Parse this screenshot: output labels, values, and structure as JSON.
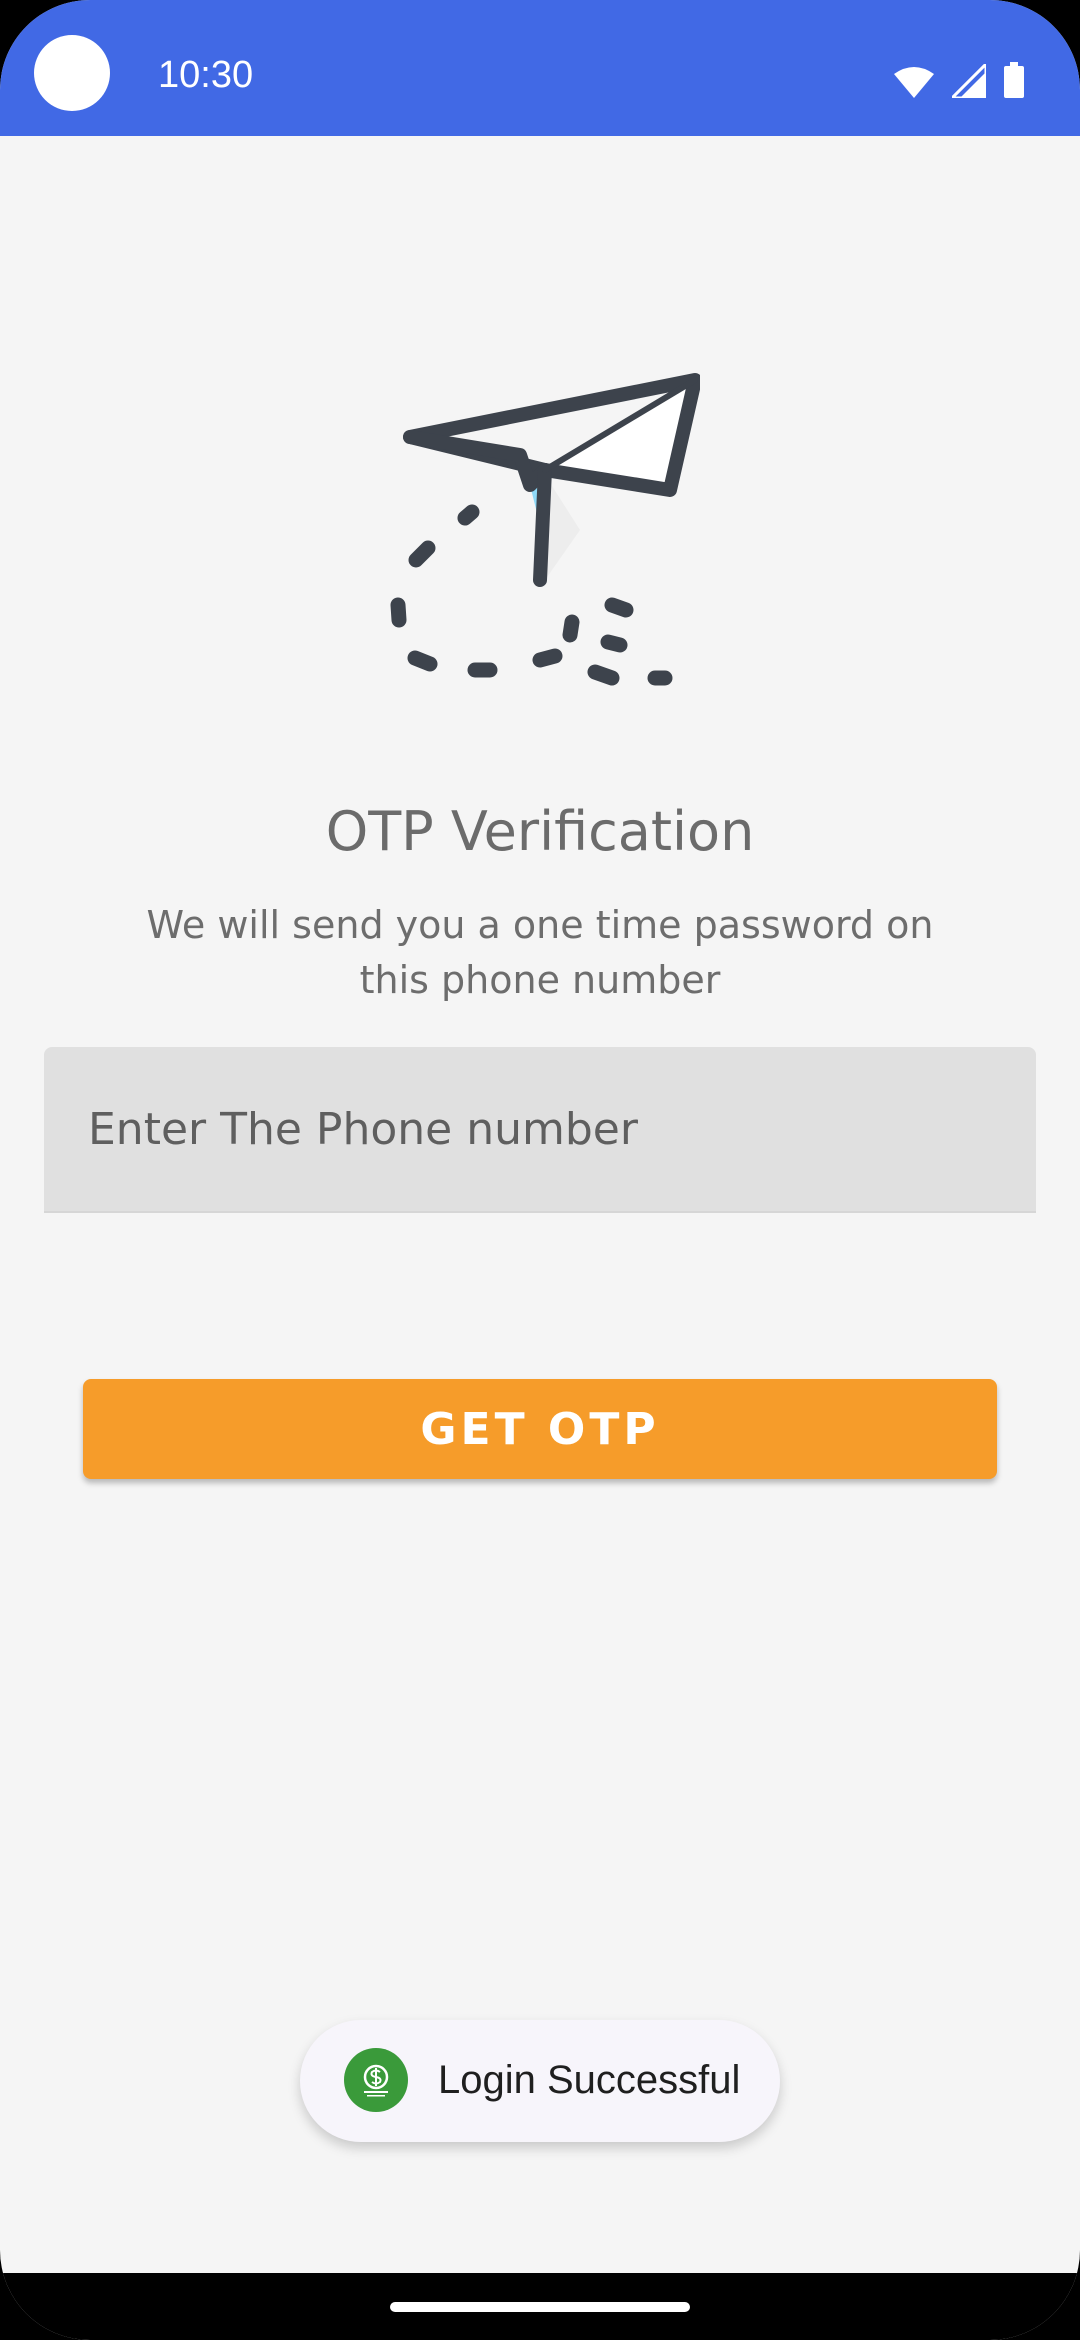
{
  "status_bar": {
    "time": "10:30",
    "accent": "#4169e5",
    "icons": [
      "wifi-icon",
      "cell-signal-icon",
      "battery-icon"
    ]
  },
  "main": {
    "illustration": "paper-plane-icon",
    "title": "OTP Verification",
    "subtitle": "We will send you a one time password on this phone number",
    "phone_placeholder": "Enter The Phone number",
    "phone_value": "",
    "button_label": "GET OTP",
    "button_color": "#f69c2a"
  },
  "toast": {
    "logo": "app-logo-icon",
    "message": "Login Successful",
    "logo_color": "#3a9a3a"
  }
}
